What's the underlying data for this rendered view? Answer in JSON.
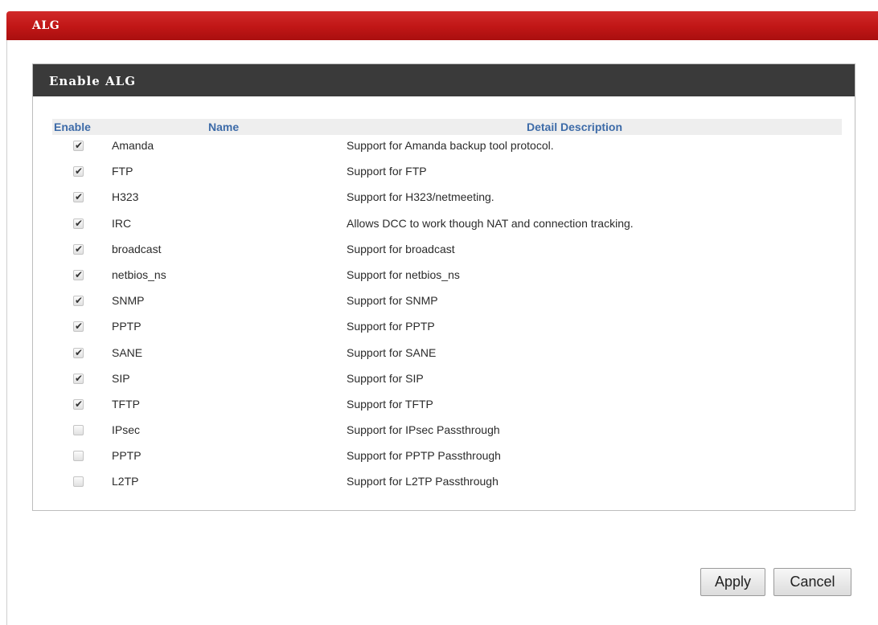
{
  "window": {
    "title": "ALG",
    "accent_color": "#c01616"
  },
  "panel": {
    "title": "Enable ALG",
    "header_color": "#3a3a3a"
  },
  "table": {
    "columns": {
      "enable": "Enable",
      "name": "Name",
      "description": "Detail Description"
    },
    "rows": [
      {
        "enabled": true,
        "name": "Amanda",
        "description": "Support for Amanda backup tool protocol."
      },
      {
        "enabled": true,
        "name": "FTP",
        "description": "Support for FTP"
      },
      {
        "enabled": true,
        "name": "H323",
        "description": "Support for H323/netmeeting."
      },
      {
        "enabled": true,
        "name": "IRC",
        "description": "Allows DCC to work though NAT and connection tracking."
      },
      {
        "enabled": true,
        "name": "broadcast",
        "description": "Support for broadcast"
      },
      {
        "enabled": true,
        "name": "netbios_ns",
        "description": "Support for netbios_ns"
      },
      {
        "enabled": true,
        "name": "SNMP",
        "description": "Support for SNMP"
      },
      {
        "enabled": true,
        "name": "PPTP",
        "description": "Support for PPTP"
      },
      {
        "enabled": true,
        "name": "SANE",
        "description": "Support for SANE"
      },
      {
        "enabled": true,
        "name": "SIP",
        "description": "Support for SIP"
      },
      {
        "enabled": true,
        "name": "TFTP",
        "description": "Support for TFTP"
      },
      {
        "enabled": false,
        "name": "IPsec",
        "description": "Support for IPsec Passthrough"
      },
      {
        "enabled": false,
        "name": "PPTP",
        "description": "Support for PPTP Passthrough"
      },
      {
        "enabled": false,
        "name": "L2TP",
        "description": "Support for L2TP Passthrough"
      }
    ]
  },
  "buttons": {
    "apply": "Apply",
    "cancel": "Cancel"
  }
}
